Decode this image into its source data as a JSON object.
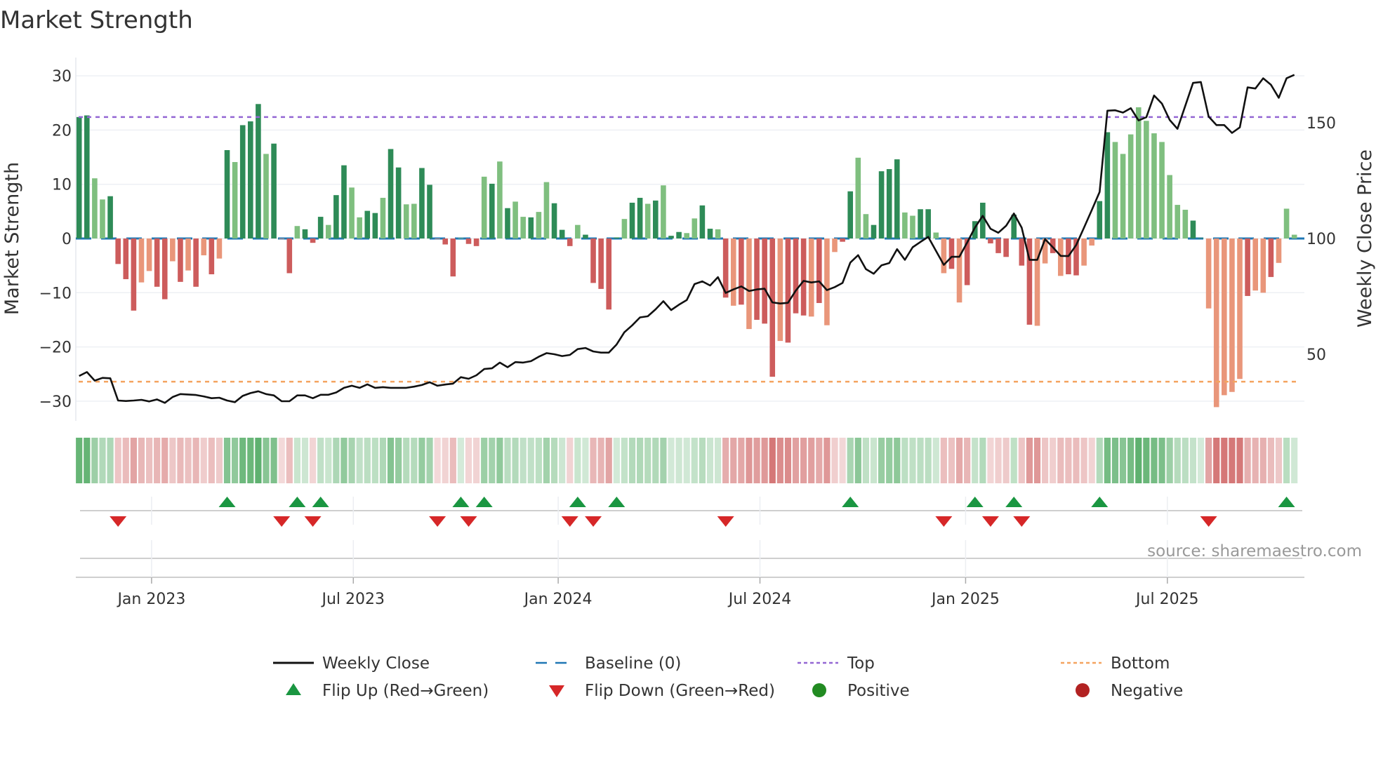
{
  "chart_data": {
    "type": "bar",
    "title": "Market Strength",
    "ylabel": "Market Strength",
    "y2label": "Weekly Close Price",
    "ylim": [
      -34,
      34
    ],
    "y_ticks": [
      30,
      20,
      10,
      0,
      -10,
      -20,
      -30
    ],
    "y_tick_labels": [
      "30",
      "20",
      "10",
      "0",
      "−10",
      "−20",
      "−30"
    ],
    "y2_ticks": [
      150,
      100,
      50
    ],
    "y2_tick_labels": [
      "150",
      "100",
      "50"
    ],
    "x_ticks": [
      {
        "label": "Jan 2023",
        "week_index": 9.3
      },
      {
        "label": "Jul 2023",
        "week_index": 35.2
      },
      {
        "label": "Jan 2024",
        "week_index": 61.5
      },
      {
        "label": "Jul 2024",
        "week_index": 87.4
      },
      {
        "label": "Jan 2025",
        "week_index": 113.8
      },
      {
        "label": "Jul 2025",
        "week_index": 139.7
      }
    ],
    "top_level": 22.4,
    "bottom_level": -26.4,
    "baseline": 0,
    "strength": [
      22.4,
      22.7,
      11.1,
      7.2,
      7.8,
      -4.7,
      -7.5,
      -13.3,
      -8.1,
      -6.0,
      -8.9,
      -11.2,
      -4.2,
      -8.0,
      -5.9,
      -8.9,
      -3.1,
      -6.6,
      -3.7,
      16.3,
      14.1,
      20.9,
      21.6,
      24.8,
      15.6,
      17.5,
      -0.1,
      -6.4,
      2.3,
      1.7,
      -0.8,
      4.0,
      2.5,
      8.0,
      13.5,
      9.4,
      3.9,
      5.1,
      4.7,
      7.5,
      16.5,
      13.1,
      6.3,
      6.4,
      13.0,
      9.9,
      -0.1,
      -1.1,
      -7.0,
      0.1,
      -1.0,
      -1.4,
      11.4,
      10.1,
      14.2,
      5.6,
      6.8,
      4.0,
      3.9,
      4.9,
      10.4,
      6.5,
      1.6,
      -1.4,
      2.5,
      0.7,
      -8.2,
      -9.3,
      -13.1,
      0.2,
      3.6,
      6.6,
      7.5,
      6.4,
      7.0,
      9.8,
      0.5,
      1.2,
      1.0,
      3.7,
      6.1,
      1.8,
      1.7,
      -10.9,
      -12.4,
      -12.2,
      -16.7,
      -15.0,
      -15.7,
      -25.5,
      -18.9,
      -19.2,
      -13.8,
      -14.2,
      -14.4,
      -11.9,
      -16.0,
      -2.5,
      -0.6,
      8.7,
      14.9,
      4.5,
      2.5,
      12.4,
      12.8,
      14.6,
      4.8,
      4.2,
      5.4,
      5.4,
      1.1,
      -6.4,
      -5.6,
      -11.8,
      -8.6,
      3.2,
      6.6,
      -0.9,
      -2.7,
      -3.4,
      4.4,
      -5.0,
      -15.9,
      -16.1,
      -4.6,
      -2.7,
      -6.9,
      -6.6,
      -6.8,
      -5.0,
      -1.3,
      6.9,
      19.6,
      17.8,
      15.6,
      19.2,
      24.2,
      21.7,
      19.4,
      17.8,
      11.7,
      6.2,
      5.3,
      3.3,
      0.1,
      -12.9,
      -31.1,
      -28.9,
      -28.3,
      -25.9,
      -10.6,
      -9.6,
      -10.0,
      -7.1,
      -4.5,
      5.5,
      0.7
    ],
    "shade": "ddllddddllddldldldldldddldldldddlddllddlddllddlddlddldldlldlldddldddddlddldlddllddldldldddldddldllddllddddllddlldldddddddddlldlddllddllllllllllddllllldlldl",
    "weekly_close": [
      40.6,
      42.3,
      38.6,
      39.8,
      39.6,
      30.0,
      29.8,
      30.0,
      30.3,
      29.6,
      30.5,
      29.0,
      31.5,
      32.8,
      32.6,
      32.4,
      31.8,
      31.0,
      31.2,
      30.0,
      29.3,
      32.0,
      33.2,
      34.0,
      32.8,
      32.2,
      29.7,
      29.7,
      32.2,
      32.2,
      31.0,
      32.5,
      32.5,
      33.5,
      35.5,
      36.4,
      35.5,
      37.0,
      35.5,
      35.8,
      35.5,
      35.5,
      35.5,
      36.0,
      36.7,
      37.9,
      36.4,
      36.9,
      37.3,
      40.1,
      39.4,
      40.9,
      43.6,
      43.9,
      46.4,
      44.4,
      46.6,
      46.4,
      47.0,
      48.9,
      50.5,
      50.0,
      49.2,
      49.7,
      52.2,
      52.7,
      51.2,
      50.7,
      50.7,
      54.2,
      59.5,
      62.5,
      65.9,
      66.4,
      69.4,
      72.9,
      69.1,
      71.4,
      73.4,
      80.3,
      81.5,
      79.7,
      83.3,
      76.5,
      78.0,
      79.3,
      77.3,
      78.0,
      78.3,
      72.4,
      71.9,
      72.2,
      77.5,
      81.7,
      81.0,
      81.5,
      77.7,
      79.0,
      80.8,
      89.6,
      92.8,
      86.8,
      84.8,
      88.4,
      89.4,
      95.4,
      90.8,
      96.2,
      98.5,
      100.7,
      94.6,
      88.6,
      92.1,
      92.1,
      98.2,
      104.7,
      109.8,
      104.2,
      102.5,
      105.5,
      110.8,
      104.7,
      90.8,
      90.8,
      99.7,
      96.2,
      92.5,
      92.4,
      97.2,
      104.7,
      112.3,
      120.1,
      155.2,
      155.4,
      154.4,
      156.3,
      151.0,
      152.4,
      161.8,
      158.3,
      151.2,
      147.4,
      157.3,
      167.2,
      167.6,
      152.7,
      149.0,
      149.0,
      145.6,
      148.0,
      165.3,
      164.8,
      169.2,
      166.4,
      160.8,
      169.2,
      170.7
    ],
    "flip_up_weeks": [
      19,
      28,
      31,
      49,
      52,
      64,
      69,
      99,
      115,
      120,
      131,
      155
    ],
    "flip_down_weeks": [
      5,
      26,
      30,
      46,
      50,
      63,
      66,
      83,
      111,
      117,
      121,
      145
    ],
    "legend": {
      "weekly_close": "Weekly Close",
      "baseline": "Baseline (0)",
      "top": "Top",
      "bottom": "Bottom",
      "flip_up": "Flip Up (Red→Green)",
      "flip_down": "Flip Down (Green→Red)",
      "positive": "Positive",
      "negative": "Negative"
    },
    "colors": {
      "pos_dark": "#2e8b57",
      "pos_light": "#7fbf7f",
      "neg_dark": "#cd5c5c",
      "neg_light": "#e9967a",
      "top": "#9467d4",
      "bottom": "#f4a460",
      "baseline": "#1f77b4",
      "flip_up": "#1a9641",
      "flip_down": "#d62728",
      "positive_dot": "#228b22",
      "negative_dot": "#b22222"
    }
  },
  "source": "source: sharemaestro.com"
}
